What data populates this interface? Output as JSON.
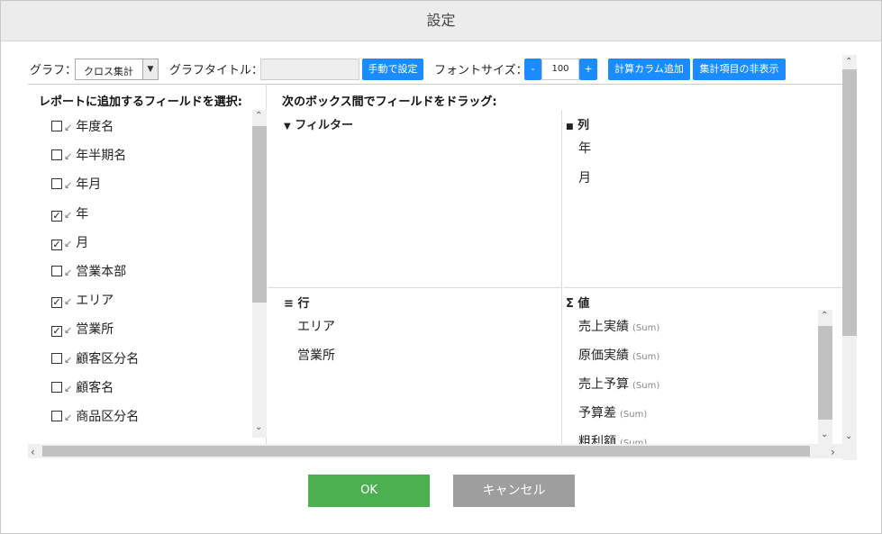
{
  "dialog": {
    "title": "設定"
  },
  "toolbar": {
    "graph_label": "グラフ：",
    "graph_value": "クロス集計",
    "graph_title_label": "グラフタイトル：",
    "graph_title_value": "",
    "manual_button": "手動で設定",
    "font_size_label": "フォントサイズ：",
    "font_minus": "-",
    "font_size_value": "100",
    "font_plus": "+",
    "add_calc_column": "計算カラム追加",
    "hide_agg_items": "集計項目の非表示"
  },
  "left_pane": {
    "heading": "レポートに追加するフィールドを選択:",
    "fields": [
      {
        "label": "年度名",
        "checked": false
      },
      {
        "label": "年半期名",
        "checked": false
      },
      {
        "label": "年月",
        "checked": false
      },
      {
        "label": "年",
        "checked": true
      },
      {
        "label": "月",
        "checked": true
      },
      {
        "label": "営業本部",
        "checked": false
      },
      {
        "label": "エリア",
        "checked": true
      },
      {
        "label": "営業所",
        "checked": true
      },
      {
        "label": "顧客区分名",
        "checked": false
      },
      {
        "label": "顧客名",
        "checked": false
      },
      {
        "label": "商品区分名",
        "checked": false
      }
    ]
  },
  "right_pane": {
    "heading": "次のボックス間でフィールドをドラッグ:",
    "filter": {
      "title": "フィルター",
      "icon": "filter-icon",
      "items": []
    },
    "columns": {
      "title": "列",
      "icon": "columns-icon",
      "items": [
        "年",
        "月"
      ]
    },
    "rows": {
      "title": "行",
      "icon": "rows-icon",
      "items": [
        "エリア",
        "営業所"
      ]
    },
    "values": {
      "title": "値",
      "icon": "sigma-icon",
      "items": [
        {
          "label": "売上実績",
          "agg": "(Sum)"
        },
        {
          "label": "原価実績",
          "agg": "(Sum)"
        },
        {
          "label": "売上予算",
          "agg": "(Sum)"
        },
        {
          "label": "予算差",
          "agg": "(Sum)"
        },
        {
          "label": "粗利額",
          "agg": "(Sum)"
        }
      ]
    }
  },
  "footer": {
    "ok": "OK",
    "cancel": "キャンセル"
  },
  "colors": {
    "primary_button": "#1a8cff",
    "ok_button": "#4caf50",
    "cancel_button": "#9e9e9e"
  }
}
